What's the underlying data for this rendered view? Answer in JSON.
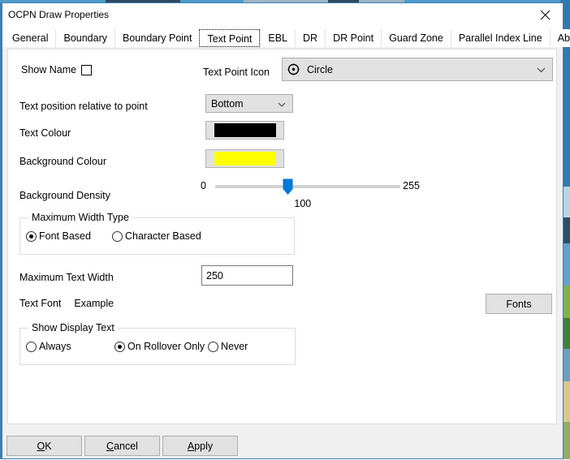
{
  "window": {
    "title": "OCPN Draw Properties",
    "close_icon": "close-icon"
  },
  "tabs": {
    "items": [
      {
        "label": "General",
        "active": false
      },
      {
        "label": "Boundary",
        "active": false
      },
      {
        "label": "Boundary Point",
        "active": false
      },
      {
        "label": "Text Point",
        "active": true
      },
      {
        "label": "EBL",
        "active": false
      },
      {
        "label": "DR",
        "active": false
      },
      {
        "label": "DR Point",
        "active": false
      },
      {
        "label": "Guard Zone",
        "active": false
      },
      {
        "label": "Parallel Index Line",
        "active": false
      },
      {
        "label": "About",
        "active": false
      }
    ],
    "scroll_left_icon": "chevron-left-icon",
    "scroll_right_icon": "chevron-right-icon"
  },
  "form": {
    "show_name": {
      "label": "Show Name",
      "checked": false
    },
    "text_point_icon": {
      "label": "Text Point Icon",
      "value": "Circle",
      "icon": "circle-dot-icon",
      "chevron": "chevron-down-icon"
    },
    "text_position": {
      "label": "Text position relative to point",
      "value": "Bottom",
      "chevron": "chevron-down-icon"
    },
    "text_colour": {
      "label": "Text Colour",
      "value": "#000000"
    },
    "background_colour": {
      "label": "Background Colour",
      "value": "#FFFF00"
    },
    "background_density": {
      "label": "Background Density",
      "min_label": "0",
      "max_label": "255",
      "value_label": "100",
      "min": 0,
      "max": 255,
      "value": 100,
      "thumb_colour": "#0078D7"
    },
    "maximum_width_type": {
      "legend": "Maximum Width Type",
      "options": [
        {
          "label": "Font Based",
          "selected": true
        },
        {
          "label": "Character Based",
          "selected": false
        }
      ]
    },
    "maximum_text_width": {
      "label": "Maximum Text Width",
      "value": "250"
    },
    "text_font": {
      "label": "Text Font",
      "example": "Example",
      "button_label": "Fonts"
    },
    "show_display_text": {
      "legend": "Show Display Text",
      "options": [
        {
          "label": "Always",
          "selected": false
        },
        {
          "label": "On Rollover Only",
          "selected": true
        },
        {
          "label": "Never",
          "selected": false
        }
      ]
    }
  },
  "footer": {
    "ok": {
      "mnemonic": "O",
      "rest": "K"
    },
    "cancel": {
      "mnemonic": "C",
      "rest": "ancel"
    },
    "apply": {
      "mnemonic": "A",
      "rest": "pply"
    }
  }
}
